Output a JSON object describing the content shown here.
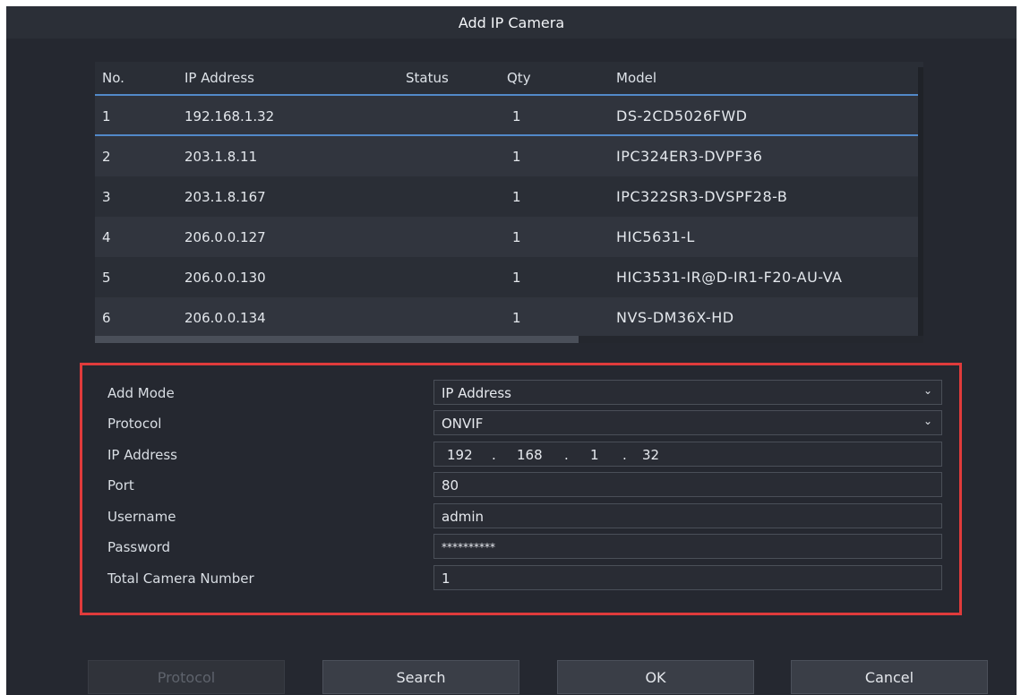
{
  "window": {
    "title": "Add IP Camera"
  },
  "device_list": {
    "headers": {
      "no": "No.",
      "ip": "IP Address",
      "status": "Status",
      "qty": "Qty",
      "model": "Model"
    },
    "rows": [
      {
        "no": "1",
        "ip": "192.168.1.32",
        "status": "",
        "qty": "1",
        "model": "DS-2CD5026FWD"
      },
      {
        "no": "2",
        "ip": "203.1.8.11",
        "status": "",
        "qty": "1",
        "model": "IPC324ER3-DVPF36"
      },
      {
        "no": "3",
        "ip": "203.1.8.167",
        "status": "",
        "qty": "1",
        "model": "IPC322SR3-DVSPF28-B"
      },
      {
        "no": "4",
        "ip": "206.0.0.127",
        "status": "",
        "qty": "1",
        "model": "HIC5631-L"
      },
      {
        "no": "5",
        "ip": "206.0.0.130",
        "status": "",
        "qty": "1",
        "model": "HIC3531-IR@D-IR1-F20-AU-VA"
      },
      {
        "no": "6",
        "ip": "206.0.0.134",
        "status": "",
        "qty": "1",
        "model": "NVS-DM36X-HD"
      }
    ]
  },
  "form": {
    "add_mode": {
      "label": "Add Mode",
      "value": "IP Address"
    },
    "protocol": {
      "label": "Protocol",
      "value": "ONVIF"
    },
    "ip_address": {
      "label": "IP Address",
      "octets": [
        "192",
        "168",
        "1",
        "32"
      ],
      "separator": "."
    },
    "port": {
      "label": "Port",
      "value": "80"
    },
    "username": {
      "label": "Username",
      "value": "admin"
    },
    "password": {
      "label": "Password",
      "value": "**********"
    },
    "total_camera_number": {
      "label": "Total Camera Number",
      "value": "1"
    }
  },
  "buttons": {
    "protocol": "Protocol",
    "search": "Search",
    "ok": "OK",
    "cancel": "Cancel"
  },
  "colors": {
    "background": "#252830",
    "accent": "#5289c9",
    "highlight_border": "#e03b3b"
  }
}
